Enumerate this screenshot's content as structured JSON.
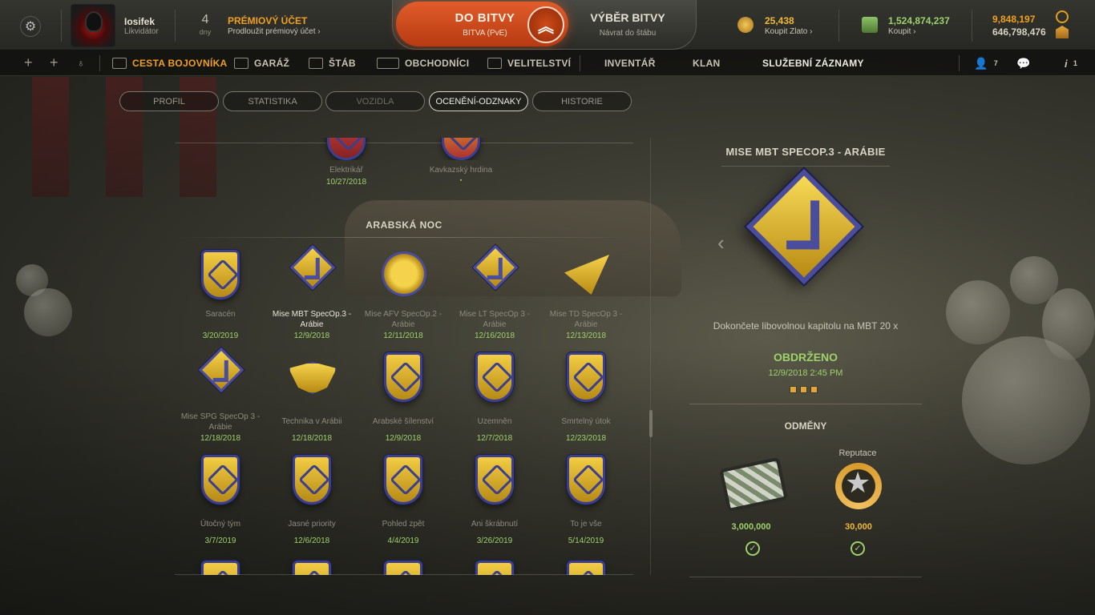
{
  "player": {
    "name": "Iosifek",
    "rank": "Likvidátor"
  },
  "premium": {
    "days": "4",
    "days_label": "dny",
    "title": "PRÉMIOVÝ ÚČET",
    "subtitle": "Prodloužit prémiový účet ›"
  },
  "battle": {
    "main": "DO BITVY",
    "sub": "BITVA (PvE)",
    "select_main": "VÝBĚR BITVY",
    "select_sub": "Návrat do štábu"
  },
  "currency": {
    "gold_value": "25,438",
    "gold_action": "Koupit Zlato ›",
    "credits_value": "1,524,874,237",
    "credits_action": "Koupit ›",
    "xp1": "9,848,197",
    "xp2": "646,798,476"
  },
  "nav": {
    "items": [
      "CESTA BOJOVNÍKA",
      "GARÁŽ",
      "ŠTÁB",
      "OBCHODNÍCI",
      "VELITELSTVÍ",
      "INVENTÁŘ",
      "KLAN",
      "SLUŽEBNÍ ZÁZNAMY"
    ],
    "friends_count": "7",
    "notif_count": "1"
  },
  "tabs": [
    "PROFIL",
    "STATISTIKA",
    "VOZIDLA",
    "OCENĚNÍ-ODZNAKY",
    "HISTORIE"
  ],
  "top_row": [
    {
      "name": "Elektrikář",
      "date": "10/27/2018"
    },
    {
      "name": "Kavkazský hrdina",
      "date": "▪"
    }
  ],
  "section_title": "ARABSKÁ NOC",
  "medals": [
    {
      "name": "Saracén",
      "date": "3/20/2019",
      "icon": "checkered-flags-shield"
    },
    {
      "name": "Mise MBT SpecOp.3 - Arábie",
      "date": "12/9/2018",
      "icon": "diamond-check"
    },
    {
      "name": "Mise AFV SpecOp.2 - Arábie",
      "date": "12/11/2018",
      "icon": "ring-check"
    },
    {
      "name": "Mise LT SpecOp 3 - Arábie",
      "date": "12/16/2018",
      "icon": "diamond-check"
    },
    {
      "name": "Mise TD SpecOp 3 - Arábie",
      "date": "12/13/2018",
      "icon": "triangle-check"
    },
    {
      "name": "Mise SPG SpecOp 3 - Arábie",
      "date": "12/18/2018",
      "icon": "chevron-check"
    },
    {
      "name": "Technika v Arábii",
      "date": "12/18/2018",
      "icon": "hat-badge"
    },
    {
      "name": "Arabské šílenství",
      "date": "12/9/2018",
      "icon": "crown-shield"
    },
    {
      "name": "Uzemněn",
      "date": "12/7/2018",
      "icon": "helicopter-shield"
    },
    {
      "name": "Smrtelný útok",
      "date": "12/23/2018",
      "icon": "clock-shield"
    },
    {
      "name": "Útočný tým",
      "date": "3/7/2019",
      "icon": "crosshair-shield"
    },
    {
      "name": "Jasné priority",
      "date": "12/6/2018",
      "icon": "cross-shield"
    },
    {
      "name": "Pohled zpět",
      "date": "4/4/2019",
      "icon": "missiles-shield"
    },
    {
      "name": "Ani škrábnutí",
      "date": "3/26/2019",
      "icon": "castle-shield"
    },
    {
      "name": "To je vše",
      "date": "5/14/2019",
      "icon": "plane-shield"
    }
  ],
  "detail": {
    "title": "MISE MBT SPECOP.3 - ARÁBIE",
    "description": "Dokončete libovolnou kapitolu na MBT 20 x",
    "status": "OBDRŽENO",
    "date": "12/9/2018 2:45 PM",
    "rewards_title": "ODMĚNY",
    "rep_label": "Reputace",
    "reward_credits": "3,000,000",
    "reward_rep": "30,000"
  },
  "colors": {
    "accent": "#f0a020",
    "green": "#9dd16b",
    "medal_gold": "#f3cd44",
    "medal_blue": "#3c3f8c"
  }
}
